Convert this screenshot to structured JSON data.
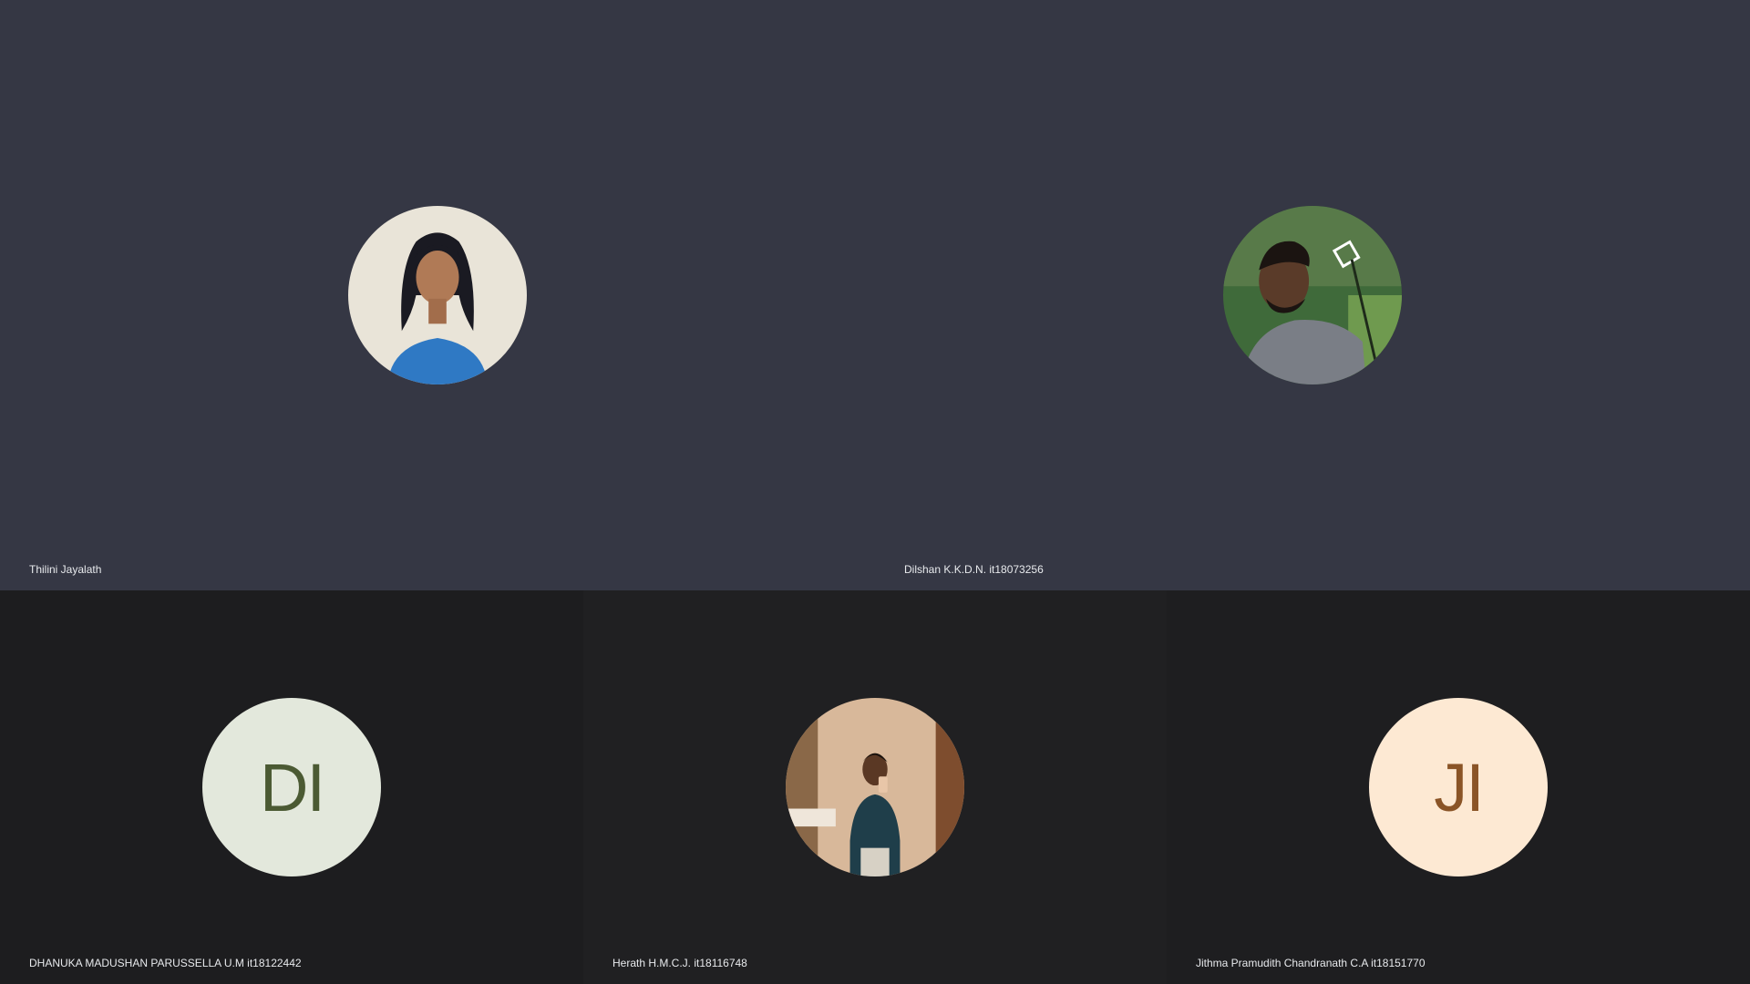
{
  "participants": [
    {
      "name": "Thilini Jayalath",
      "avatar": "photo-woman-blue-top"
    },
    {
      "name": "Dilshan K.K.D.N. it18073256",
      "avatar": "photo-man-outdoors"
    },
    {
      "name": "DHANUKA MADUSHAN PARUSSELLA U.M it18122442",
      "initials": "DI"
    },
    {
      "name": "Herath H.M.C.J. it18116748",
      "avatar": "photo-man-mirror-selfie"
    },
    {
      "name": "Jithma Pramudith Chandranath C.A it18151770",
      "initials": "JI"
    }
  ],
  "colors": {
    "top_tile_bg": "#353744",
    "bottom_tile_bg": "#1d1d1f",
    "initials_di_bg": "#e3e8dc",
    "initials_di_fg": "#4b5a33",
    "initials_ji_bg": "#fde9d3",
    "initials_ji_fg": "#8a5426",
    "label_text": "#e8eaed"
  }
}
